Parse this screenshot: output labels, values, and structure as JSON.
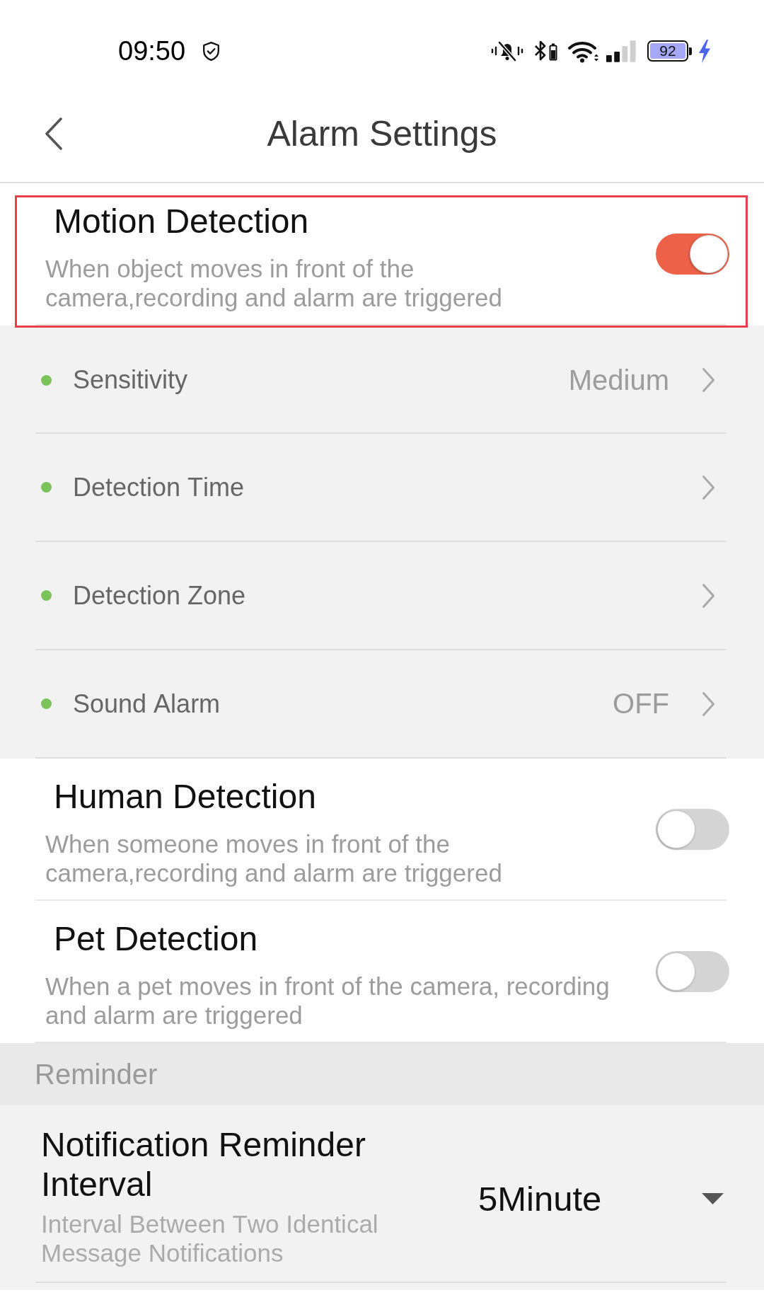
{
  "status_bar": {
    "time": "09:50",
    "battery": "92"
  },
  "header": {
    "title": "Alarm Settings"
  },
  "detections": [
    {
      "title": "Motion Detection",
      "description": "When object moves in front of the camera,recording and alarm are triggered",
      "on": true,
      "highlighted": true,
      "options": [
        {
          "label": "Sensitivity",
          "value": "Medium"
        },
        {
          "label": "Detection Time"
        },
        {
          "label": "Detection Zone"
        },
        {
          "label": "Sound Alarm",
          "value": "OFF"
        }
      ]
    },
    {
      "title": "Human Detection",
      "description": "When someone moves in front of the camera,recording and alarm are triggered",
      "on": false,
      "highlighted": false
    },
    {
      "title": "Pet Detection",
      "description": "When a pet moves in front of the camera, recording and alarm are triggered",
      "on": false,
      "highlighted": false
    }
  ],
  "reminder": {
    "title": "Reminder",
    "settings": [
      {
        "title": "Notification Reminder Interval",
        "description": "Interval Between Two Identical Message Notifications",
        "value": "5Minute"
      }
    ]
  }
}
